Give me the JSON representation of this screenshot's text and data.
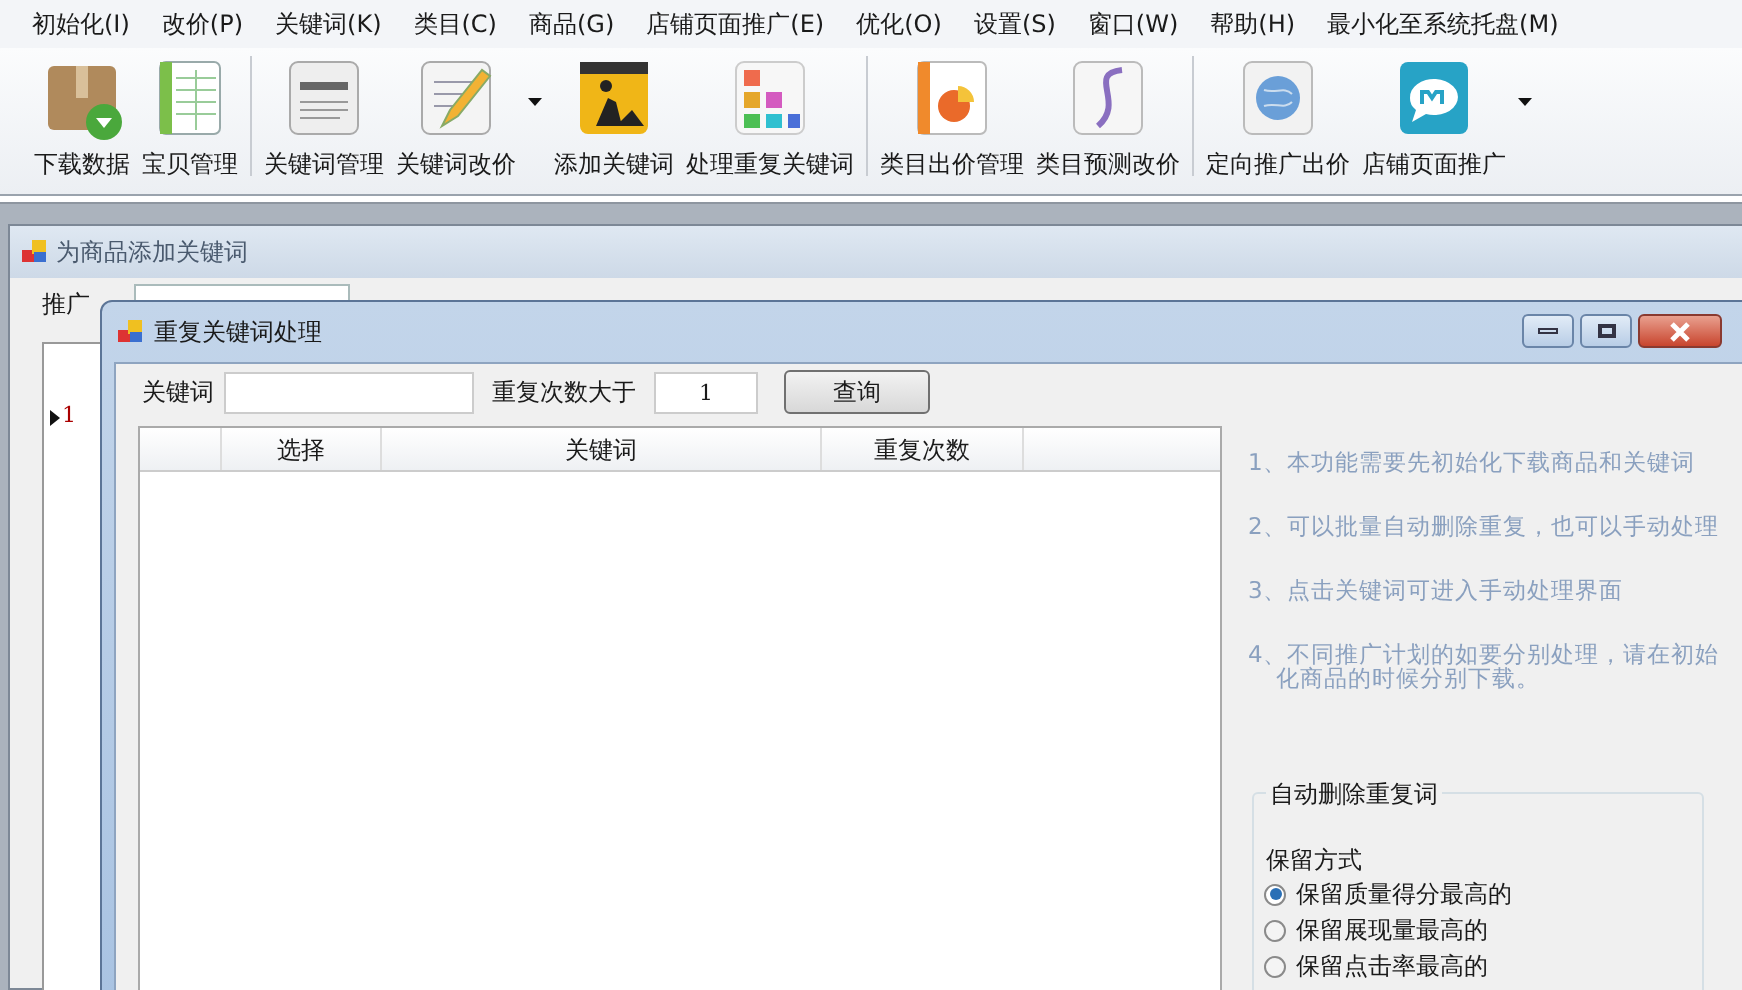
{
  "menu": [
    "初始化(I)",
    "改价(P)",
    "关键词(K)",
    "类目(C)",
    "商品(G)",
    "店铺页面推广(E)",
    "优化(O)",
    "设置(S)",
    "窗口(W)",
    "帮助(H)",
    "最小化至系统托盘(M)"
  ],
  "toolbar": [
    {
      "label": "下载数据",
      "kind": "box",
      "dropdown": false,
      "separator_after": false
    },
    {
      "label": "宝贝管理",
      "kind": "sheet",
      "dropdown": false,
      "separator_after": true
    },
    {
      "label": "关键词管理",
      "kind": "abc",
      "dropdown": false,
      "separator_after": false
    },
    {
      "label": "关键词改价",
      "kind": "pencil",
      "dropdown": true,
      "separator_after": false
    },
    {
      "label": "添加关键词",
      "kind": "worker",
      "dropdown": false,
      "separator_after": false
    },
    {
      "label": "处理重复关键词",
      "kind": "tiles",
      "dropdown": false,
      "separator_after": true
    },
    {
      "label": "类目出价管理",
      "kind": "pie",
      "dropdown": false,
      "separator_after": false
    },
    {
      "label": "类目预测改价",
      "kind": "curve",
      "dropdown": false,
      "separator_after": true
    },
    {
      "label": "定向推广出价",
      "kind": "globe",
      "dropdown": false,
      "separator_after": false
    },
    {
      "label": "店铺页面推广",
      "kind": "bubble",
      "dropdown": true,
      "separator_after": false
    }
  ],
  "parent_window": {
    "title": "为商品添加关键词",
    "filter_label": "推广",
    "row_marker": "1"
  },
  "dialog": {
    "title": "重复关键词处理",
    "keyword_label": "关键词",
    "count_label": "重复次数大于",
    "count_value": "1",
    "query_button": "查询",
    "table": {
      "columns": [
        "选择",
        "关键词",
        "重复次数"
      ]
    },
    "notes": [
      "1、本功能需要先初始化下载商品和关键词",
      "2、可以批量自动删除重复，也可以手动处理",
      "3、点击关键词可进入手动处理界面",
      "4、不同推广计划的如要分别处理，请在初始化商品的时候分别下载。"
    ],
    "group": {
      "title": "自动删除重复词",
      "subtitle": "保留方式",
      "options": [
        {
          "label": "保留质量得分最高的",
          "selected": true
        },
        {
          "label": "保留展现量最高的",
          "selected": false
        },
        {
          "label": "保留点击率最高的",
          "selected": false
        }
      ]
    }
  }
}
